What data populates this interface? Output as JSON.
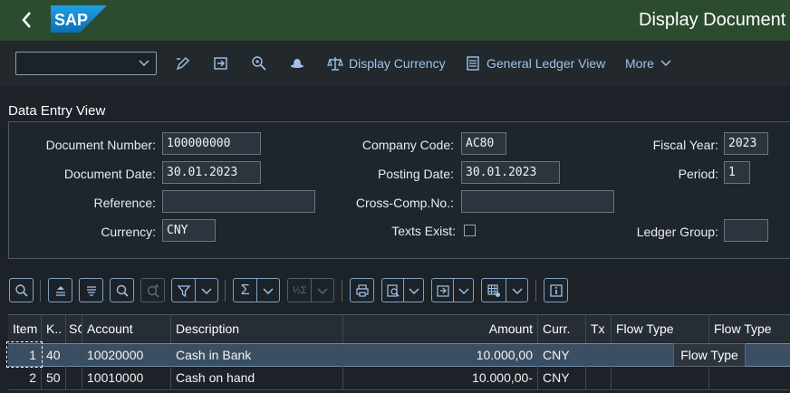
{
  "shell": {
    "title": "Display Document",
    "logo": "SAP"
  },
  "toolbar": {
    "display_currency": "Display Currency",
    "general_ledger_view": "General Ledger View",
    "more": "More"
  },
  "section": {
    "title": "Data Entry View"
  },
  "header": {
    "document_number_label": "Document Number:",
    "document_number": "100000000",
    "company_code_label": "Company Code:",
    "company_code": "AC80",
    "fiscal_year_label": "Fiscal Year:",
    "fiscal_year": "2023",
    "document_date_label": "Document Date:",
    "document_date": "30.01.2023",
    "posting_date_label": "Posting Date:",
    "posting_date": "30.01.2023",
    "period_label": "Period:",
    "period": "1",
    "reference_label": "Reference:",
    "reference": "",
    "cross_comp_label": "Cross-Comp.No.:",
    "cross_comp": "",
    "currency_label": "Currency:",
    "currency": "CNY",
    "texts_exist_label": "Texts Exist:",
    "ledger_group_label": "Ledger Group:",
    "ledger_group": ""
  },
  "table": {
    "columns": [
      "Item",
      "K..",
      "SG",
      "Account",
      "Description",
      "Amount",
      "Curr.",
      "Tx",
      "Flow Type",
      "Flow Type"
    ],
    "rows": [
      {
        "item": "1",
        "key": "40",
        "sg": "",
        "account": "10020000",
        "description": "Cash in Bank",
        "amount": "10.000,00",
        "curr": "CNY",
        "tx": "",
        "flow1": "",
        "flow2": ""
      },
      {
        "item": "2",
        "key": "50",
        "sg": "",
        "account": "10010000",
        "description": "Cash on hand",
        "amount": "10.000,00-",
        "curr": "CNY",
        "tx": "",
        "flow1": "",
        "flow2": ""
      }
    ],
    "tooltip": "Flow Type"
  }
}
